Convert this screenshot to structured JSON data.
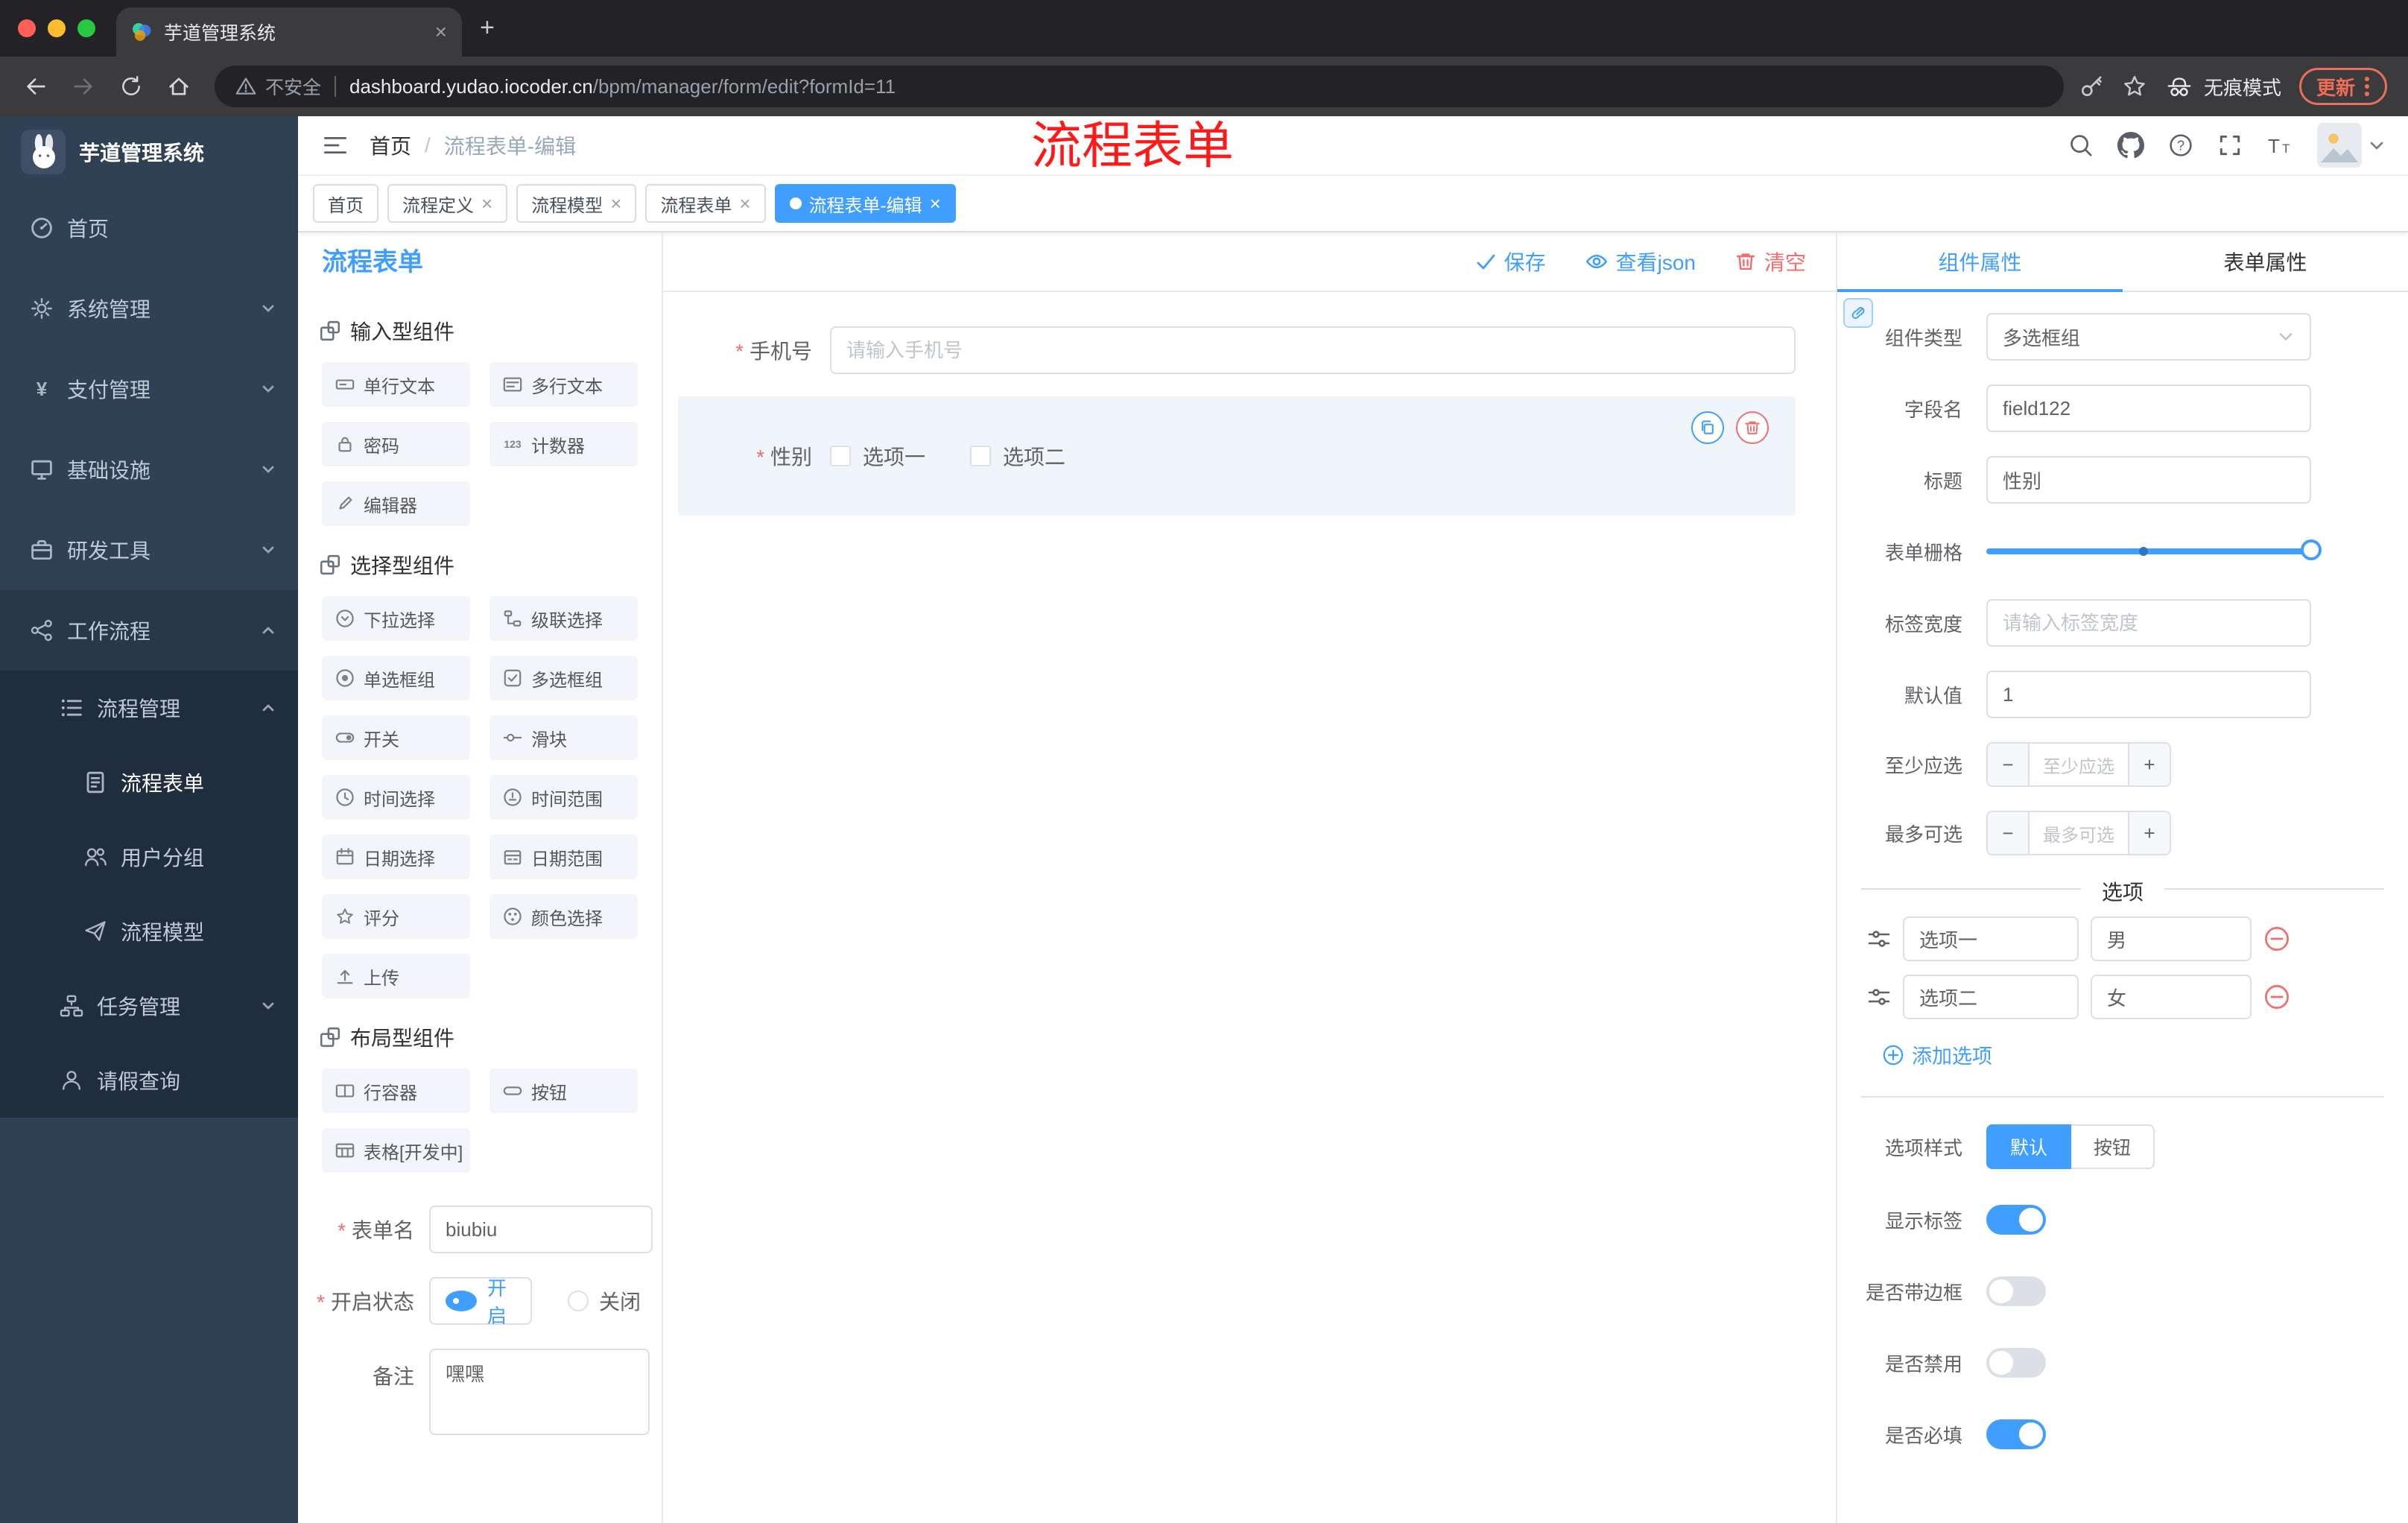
{
  "colors": {
    "accent": "#409eff",
    "danger": "#f56c6c",
    "sidebar_bg": "#304156",
    "annotation_red": "#ff1a1a"
  },
  "browser": {
    "tab": {
      "title": "芋道管理系统"
    },
    "toolbar": {
      "security_label": "不安全",
      "url_host": "dashboard.yudao.iocoder.cn",
      "url_path": "/bpm/manager/form/edit?formId=11",
      "incognito_label": "无痕模式",
      "update_label": "更新"
    }
  },
  "sidebar": {
    "logo_title": "芋道管理系统",
    "menu": [
      {
        "label": "首页"
      },
      {
        "label": "系统管理"
      },
      {
        "label": "支付管理"
      },
      {
        "label": "基础设施"
      },
      {
        "label": "研发工具"
      },
      {
        "label": "工作流程"
      },
      {
        "label": "流程管理"
      },
      {
        "label": "流程表单"
      },
      {
        "label": "用户分组"
      },
      {
        "label": "流程模型"
      },
      {
        "label": "任务管理"
      },
      {
        "label": "请假查询"
      }
    ]
  },
  "header": {
    "breadcrumb": [
      "首页",
      "流程表单-编辑"
    ],
    "annotation": "流程表单"
  },
  "tags": [
    {
      "label": "首页"
    },
    {
      "label": "流程定义"
    },
    {
      "label": "流程模型"
    },
    {
      "label": "流程表单"
    },
    {
      "label": "流程表单-编辑"
    }
  ],
  "designer": {
    "title": "流程表单",
    "actions": {
      "save": "保存",
      "view_json": "查看json",
      "clear": "清空"
    }
  },
  "palette": {
    "groups": [
      {
        "title": "输入型组件",
        "items": [
          "单行文本",
          "多行文本",
          "密码",
          "计数器",
          "编辑器"
        ]
      },
      {
        "title": "选择型组件",
        "items": [
          "下拉选择",
          "级联选择",
          "单选框组",
          "多选框组",
          "开关",
          "滑块",
          "时间选择",
          "时间范围",
          "日期选择",
          "日期范围",
          "评分",
          "颜色选择",
          "上传"
        ]
      },
      {
        "title": "布局型组件",
        "items": [
          "行容器",
          "按钮",
          "表格[开发中]"
        ]
      }
    ],
    "form": {
      "name_label": "表单名",
      "name_value": "biubiu",
      "status_label": "开启状态",
      "status_on": "开启",
      "status_off": "关闭",
      "remark_label": "备注",
      "remark_value": "嘿嘿"
    }
  },
  "canvas": {
    "phone": {
      "label": "手机号",
      "placeholder": "请输入手机号"
    },
    "gender": {
      "label": "性别",
      "options": [
        "选项一",
        "选项二"
      ]
    }
  },
  "props": {
    "tabs": [
      "组件属性",
      "表单属性"
    ],
    "fields": {
      "component_type": {
        "label": "组件类型",
        "value": "多选框组"
      },
      "field_name": {
        "label": "字段名",
        "value": "field122"
      },
      "title": {
        "label": "标题",
        "value": "性别"
      },
      "grid": {
        "label": "表单栅格"
      },
      "label_width": {
        "label": "标签宽度",
        "placeholder": "请输入标签宽度"
      },
      "default_value": {
        "label": "默认值",
        "value": "1"
      },
      "min_select": {
        "label": "至少应选",
        "placeholder": "至少应选"
      },
      "max_select": {
        "label": "最多可选",
        "placeholder": "最多可选"
      }
    },
    "options_divider": "选项",
    "options": [
      {
        "label": "选项一",
        "value": "男"
      },
      {
        "label": "选项二",
        "value": "女"
      }
    ],
    "add_option": "添加选项",
    "option_style": {
      "label": "选项样式",
      "default": "默认",
      "button": "按钮"
    },
    "toggles": [
      {
        "label": "显示标签",
        "on": true
      },
      {
        "label": "是否带边框",
        "on": false
      },
      {
        "label": "是否禁用",
        "on": false
      },
      {
        "label": "是否必填",
        "on": true
      }
    ]
  }
}
